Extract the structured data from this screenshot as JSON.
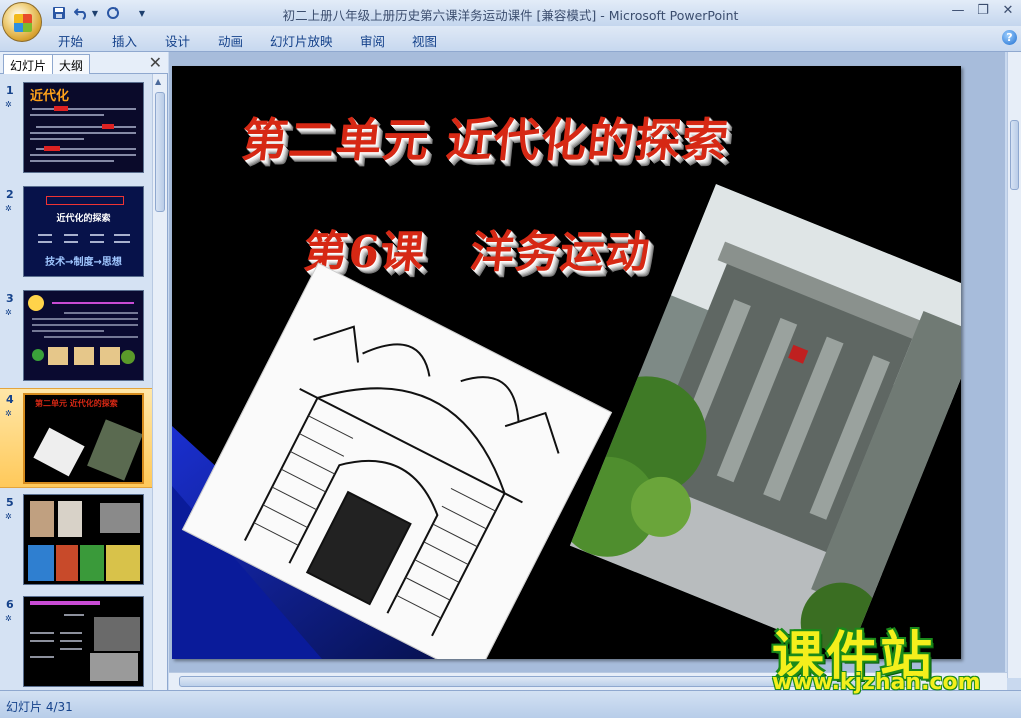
{
  "window": {
    "title": "初二上册八年级上册历史第六课洋务运动课件 [兼容模式] - Microsoft PowerPoint",
    "quick_access": {
      "save_icon": "save-icon",
      "undo_icon": "undo-icon",
      "redo_icon": "redo-icon",
      "customize_icon": "chevron-down-icon"
    },
    "controls": {
      "minimize": "—",
      "maximize": "❐",
      "close": "✕"
    }
  },
  "ribbon": {
    "tabs": [
      "开始",
      "插入",
      "设计",
      "动画",
      "幻灯片放映",
      "审阅",
      "视图"
    ],
    "help_label": "?"
  },
  "left_panel": {
    "tabs": {
      "slides": "幻灯片",
      "outline": "大纲"
    },
    "close_label": "✕",
    "thumbnails": [
      {
        "number": "1",
        "title": "近代化",
        "star": "✲"
      },
      {
        "number": "2",
        "title": "近代化的探索",
        "star": "✲",
        "bottom": "技术→制度→思想"
      },
      {
        "number": "3",
        "title": "",
        "star": "✲"
      },
      {
        "number": "4",
        "title": "第二单元 近代化的探索",
        "star": "✲",
        "selected": true
      },
      {
        "number": "5",
        "title": "",
        "star": "✲"
      },
      {
        "number": "6",
        "title": "",
        "star": "✲"
      }
    ]
  },
  "slide": {
    "title_line1": "第二单元 近代化的探索",
    "title_line2": "第6课　洋务运动",
    "background": "#000000",
    "title_color": "#d62814"
  },
  "status": {
    "slide_indicator": "幻灯片 4/31"
  },
  "watermark": {
    "main": "课件站",
    "url": "www.kjzhan.com"
  }
}
